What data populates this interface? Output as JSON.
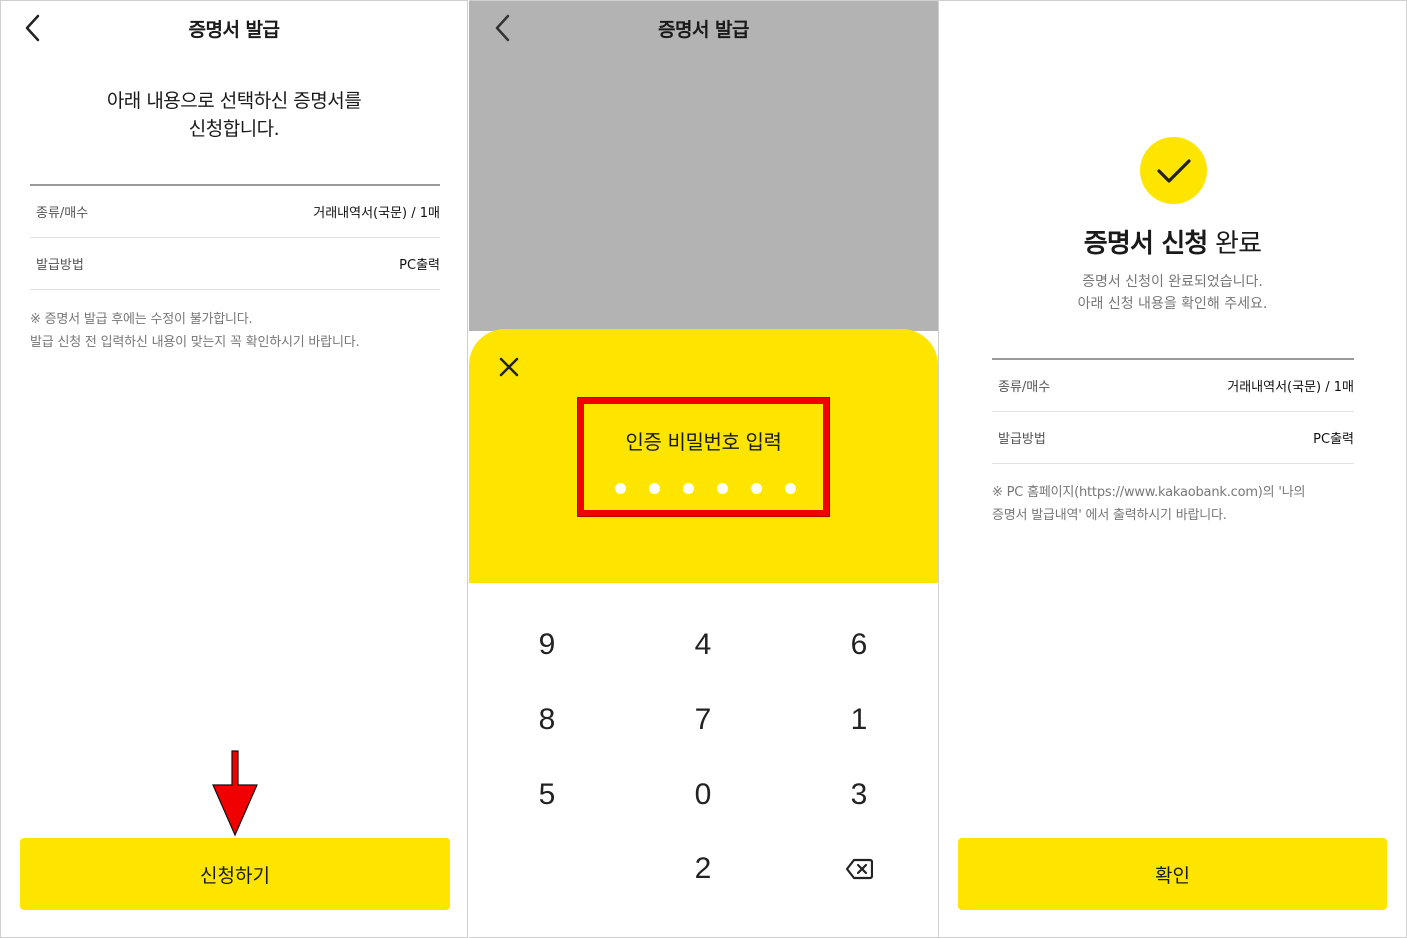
{
  "screens": {
    "apply": {
      "title": "증명서 발급",
      "intro_line1": "아래 내용으로 선택하신 증명서를",
      "intro_line2": "신청합니다.",
      "rows": [
        {
          "label": "종류/매수",
          "value": "거래내역서(국문) / 1매"
        },
        {
          "label": "발급방법",
          "value": "PC출력"
        }
      ],
      "note1": "※ 증명서 발급 후에는 수정이 불가합니다.",
      "note2": "발급 신청 전 입력하신 내용이 맞는지 꼭 확인하시기 바랍니다.",
      "submit_label": "신청하기"
    },
    "pin": {
      "title": "증명서 발급",
      "pin_title": "인증 비밀번호 입력",
      "filled_digits": 6,
      "keys": [
        "9",
        "4",
        "6",
        "8",
        "7",
        "1",
        "5",
        "0",
        "3",
        "",
        "2",
        "⌫"
      ]
    },
    "complete": {
      "title_bold": "증명서 신청",
      "title_rest": " 완료",
      "sub1": "증명서 신청이 완료되었습니다.",
      "sub2": "아래 신청 내용을 확인해 주세요.",
      "rows": [
        {
          "label": "종류/매수",
          "value": "거래내역서(국문) / 1매"
        },
        {
          "label": "발급방법",
          "value": "PC출력"
        }
      ],
      "note1": "※ PC 홈페이지(https://www.kakaobank.com)의 '나의",
      "note2": "증명서 발급내역' 에서 출력하시기 바랍니다.",
      "confirm_label": "확인"
    }
  },
  "colors": {
    "brand_yellow": "#FEE500",
    "highlight_red": "#F10000",
    "dim_gray": "#B3B3B3"
  },
  "icons": [
    "back-chevron-icon",
    "close-icon",
    "check-icon",
    "backspace-icon",
    "down-arrow-annotation"
  ]
}
